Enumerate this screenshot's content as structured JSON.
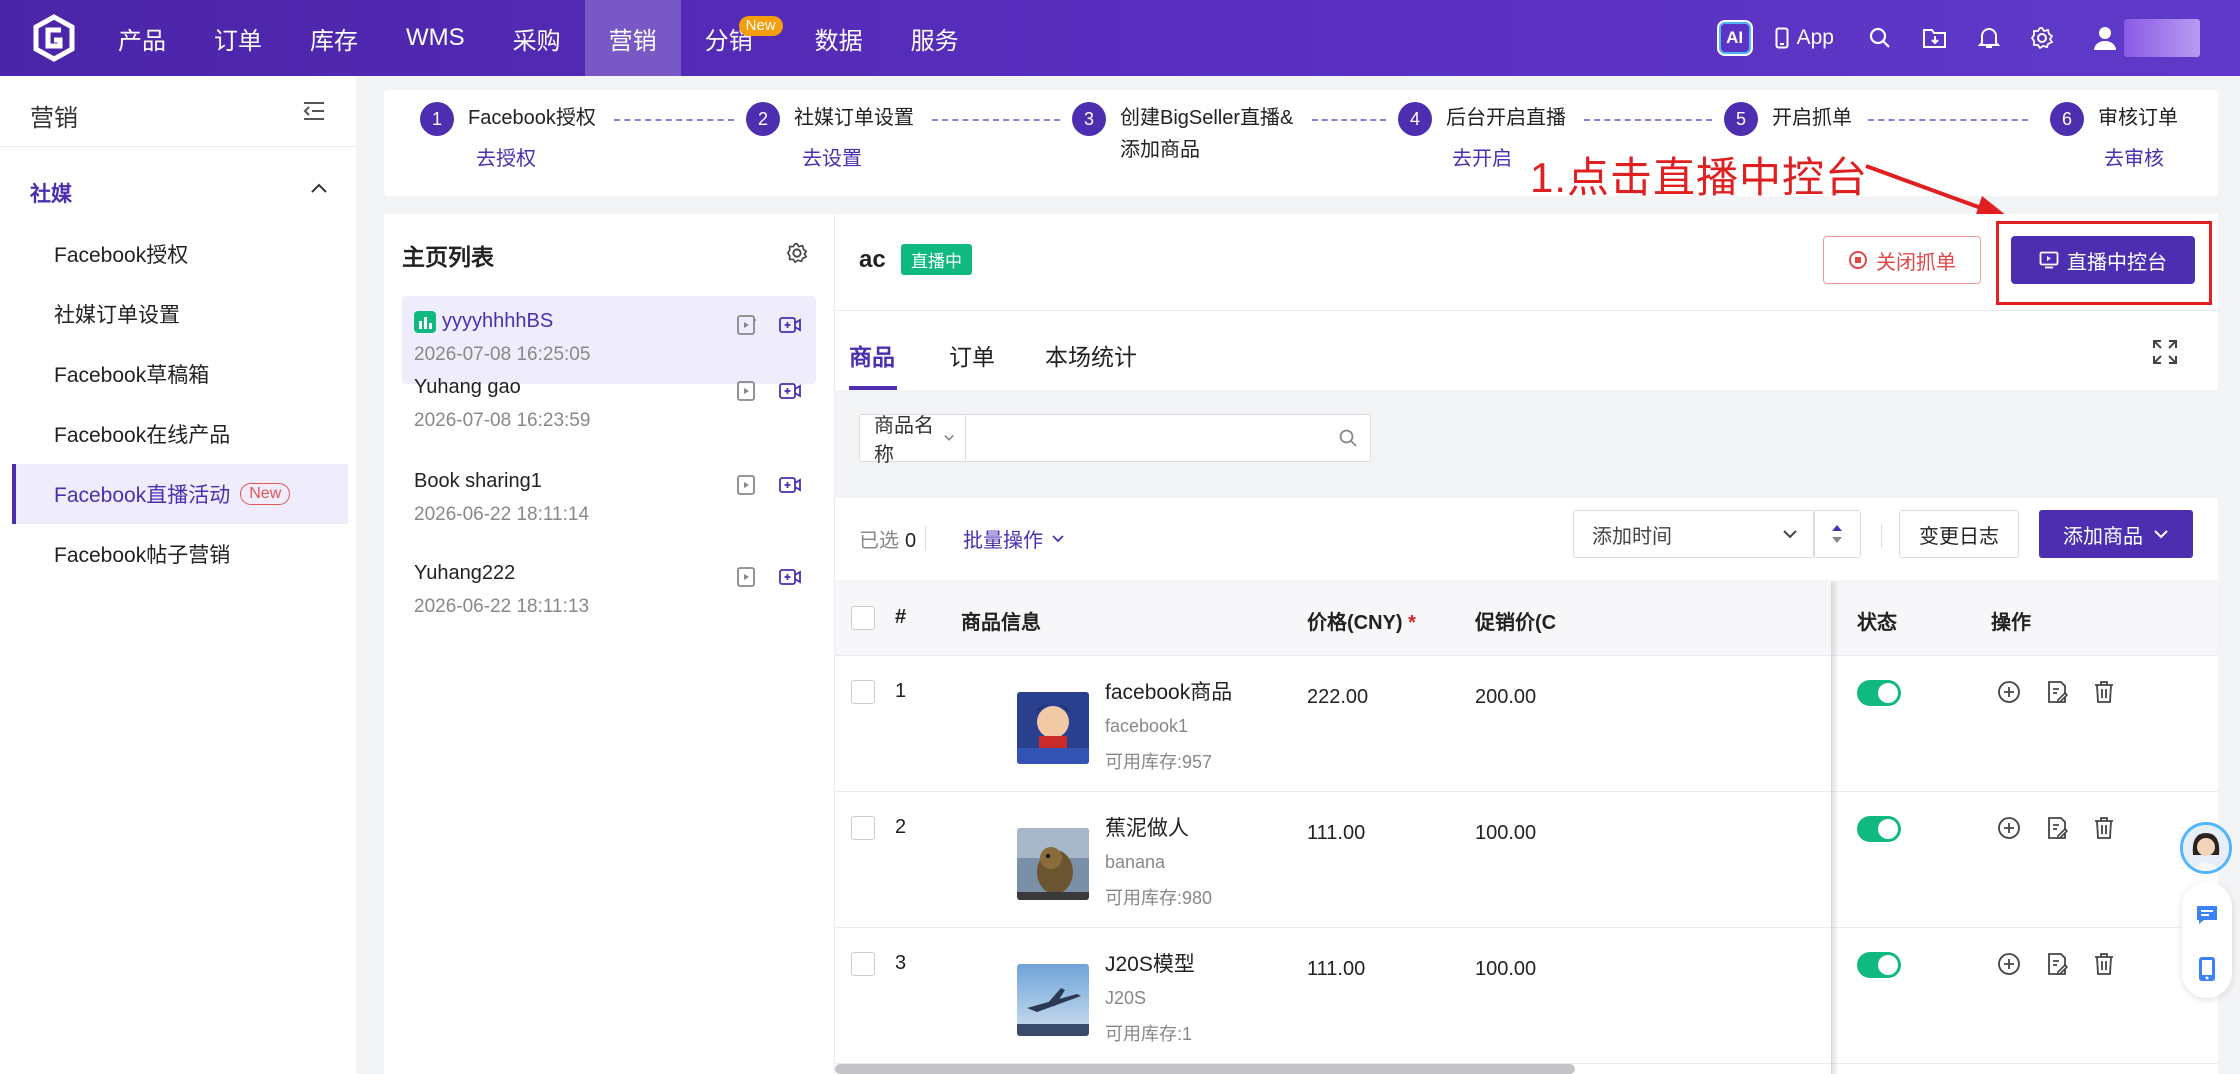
{
  "nav": {
    "items": [
      "产品",
      "订单",
      "库存",
      "WMS",
      "采购",
      "营销",
      "分销",
      "数据",
      "服务"
    ],
    "active_index": 5,
    "new_badge": "New",
    "ai_label": "AI",
    "app_label": "App"
  },
  "sidebar": {
    "title": "营销",
    "group": "社媒",
    "items": [
      {
        "label": "Facebook授权"
      },
      {
        "label": "社媒订单设置"
      },
      {
        "label": "Facebook草稿箱"
      },
      {
        "label": "Facebook在线产品"
      },
      {
        "label": "Facebook直播活动",
        "badge": "New",
        "active": true
      },
      {
        "label": "Facebook帖子营销"
      }
    ]
  },
  "steps": [
    {
      "num": "1",
      "label": "Facebook授权",
      "link": "去授权"
    },
    {
      "num": "2",
      "label": "社媒订单设置",
      "link": "去设置"
    },
    {
      "num": "3",
      "label": "创建BigSeller直播&",
      "label2": "添加商品"
    },
    {
      "num": "4",
      "label": "后台开启直播",
      "link": "去开启"
    },
    {
      "num": "5",
      "label": "开启抓单"
    },
    {
      "num": "6",
      "label": "审核订单",
      "link": "去审核"
    }
  ],
  "annotation": "1.点击直播中控台",
  "page_list": {
    "title": "主页列表",
    "items": [
      {
        "name": "yyyyhhhhBS",
        "time": "2026-07-08 16:25:05",
        "active": true
      },
      {
        "name": "Yuhang gao",
        "time": "2026-07-08 16:23:59"
      },
      {
        "name": "Book sharing1",
        "time": "2026-06-22 18:11:14"
      },
      {
        "name": "Yuhang222",
        "time": "2026-06-22 18:11:13"
      }
    ]
  },
  "main": {
    "title": "ac",
    "status": "直播中",
    "close_button": "关闭抓单",
    "console_button": "直播中控台",
    "tabs": [
      "商品",
      "订单",
      "本场统计"
    ],
    "search_select": "商品名称",
    "selected_label": "已选",
    "selected_count": "0",
    "batch_label": "批量操作",
    "sort_select": "添加时间",
    "log_button": "变更日志",
    "add_button": "添加商品"
  },
  "table": {
    "headers": {
      "index": "#",
      "info": "商品信息",
      "price": "价格(CNY)",
      "price_req": "*",
      "promo": "促销价(C",
      "status": "状态",
      "ops": "操作"
    },
    "rows": [
      {
        "index": "1",
        "name": "facebook商品",
        "sku": "facebook1",
        "stock": "可用库存:957",
        "price": "222.00",
        "promo": "200.00",
        "enabled": true
      },
      {
        "index": "2",
        "name": "蕉泥做人",
        "sku": "banana",
        "stock": "可用库存:980",
        "price": "111.00",
        "promo": "100.00",
        "enabled": true
      },
      {
        "index": "3",
        "name": "J20S模型",
        "sku": "J20S",
        "stock": "可用库存:1",
        "price": "111.00",
        "promo": "100.00",
        "enabled": true
      }
    ]
  },
  "colors": {
    "brand": "#4b2fb0",
    "live": "#10b981",
    "danger": "#e02020"
  }
}
